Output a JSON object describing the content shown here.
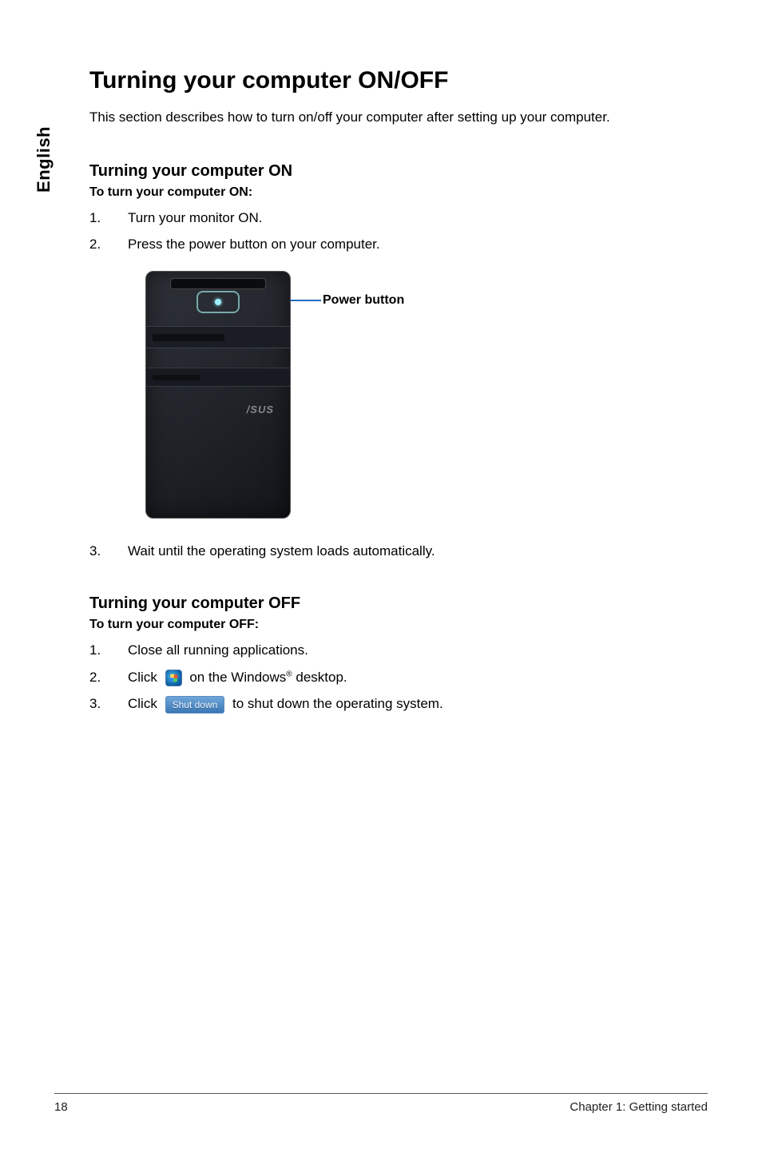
{
  "sideTab": "English",
  "title": "Turning your computer ON/OFF",
  "intro": "This section describes how to turn on/off your computer after setting up your computer.",
  "on": {
    "heading": "Turning your computer ON",
    "subheading": "To turn your computer ON:",
    "steps": {
      "n1": "1.",
      "t1": "Turn your monitor ON.",
      "n2": "2.",
      "t2": "Press the power button on your computer.",
      "n3": "3.",
      "t3": "Wait until the operating system loads automatically."
    },
    "callout": "Power button",
    "towerBrand": "/SUS"
  },
  "off": {
    "heading": "Turning your computer OFF",
    "subheading": "To turn your computer OFF:",
    "steps": {
      "n1": "1.",
      "t1": "Close all running applications.",
      "n2": "2.",
      "t2a": "Click",
      "t2b": "on the Windows",
      "t2c": " desktop.",
      "reg": "®",
      "n3": "3.",
      "t3a": "Click",
      "t3b": "to shut down the operating system.",
      "shutdownLabel": "Shut down"
    }
  },
  "footer": {
    "page": "18",
    "chapter": "Chapter 1: Getting started"
  }
}
